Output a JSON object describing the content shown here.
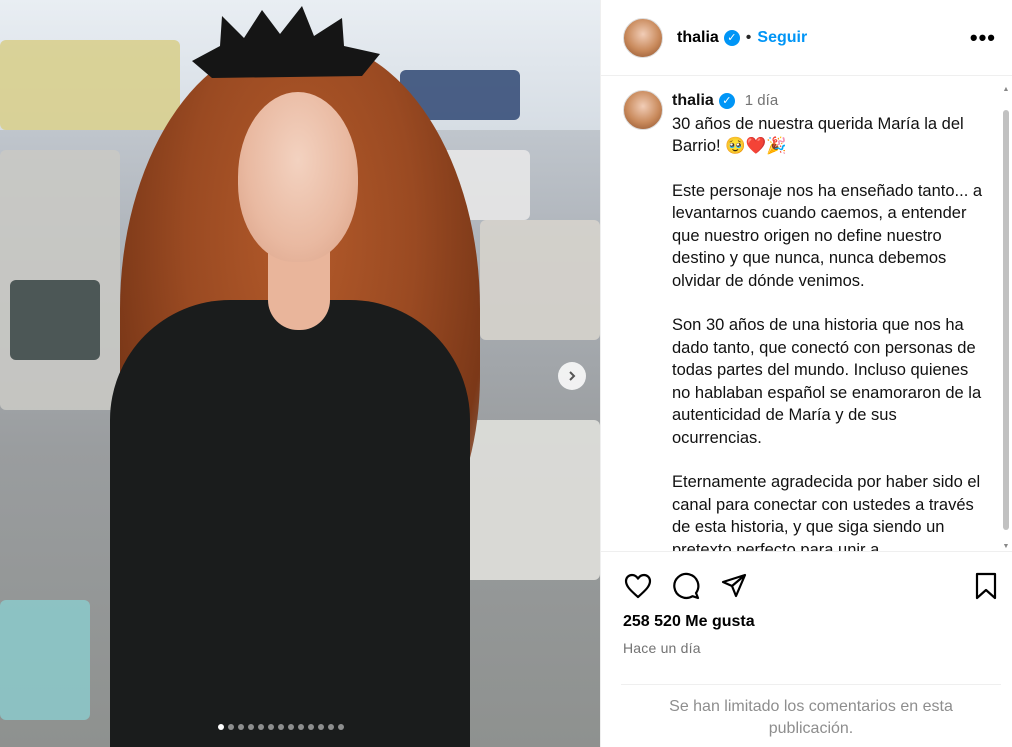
{
  "photo": {
    "next_icon": "chevron-right-icon",
    "carousel_count": 13,
    "active_index": 0
  },
  "header": {
    "username": "thalia",
    "verified_icon": "verified-badge-icon",
    "separator": "•",
    "follow_label": "Seguir",
    "more_label": "•••"
  },
  "caption": {
    "username": "thalia",
    "time": "1 día",
    "paragraphs": [
      "30 años de nuestra querida María la del Barrio! 🥹❤️🎉",
      "Este personaje nos ha enseñado tanto... a levantarnos cuando caemos, a entender que nuestro origen no define nuestro destino y que nunca, nunca debemos olvidar de dónde venimos.",
      "Son 30 años de una historia que nos ha dado tanto, que conectó con personas de todas partes del mundo. Incluso quienes no hablaban español se enamoraron de la autenticidad de María y de sus ocurrencias.",
      "Eternamente agradecida por haber sido el canal para conectar con ustedes a través de esta historia, y que siga siendo un pretexto perfecto para unir a"
    ]
  },
  "actions": {
    "like_icon": "heart-icon",
    "comment_icon": "comment-icon",
    "share_icon": "send-icon",
    "save_icon": "bookmark-icon"
  },
  "likes_text": "258 520 Me gusta",
  "time_text": "Hace un día",
  "comments_limited": "Se han limitado los comentarios en esta publicación.",
  "colors": {
    "accent": "#0095f6",
    "muted": "#737373"
  }
}
